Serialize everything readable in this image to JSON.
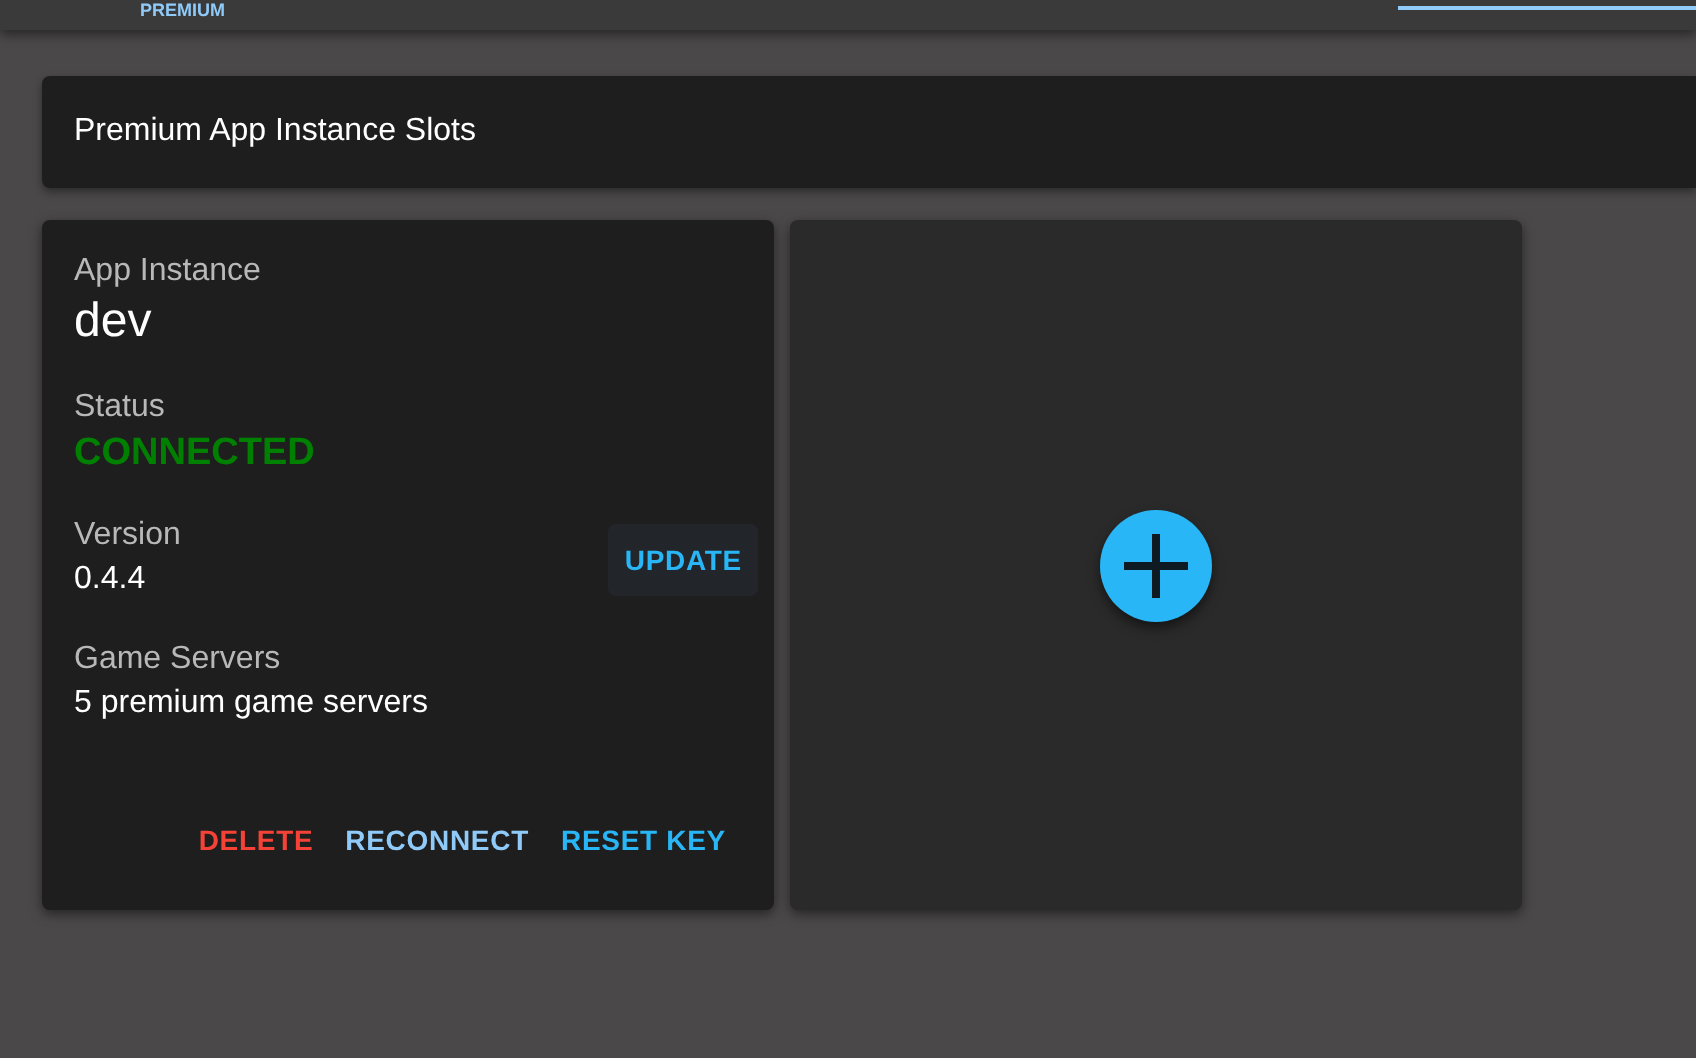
{
  "top_bar": {
    "brand_sub": "PREMIUM"
  },
  "section": {
    "title": "Premium App Instance Slots"
  },
  "instance_card": {
    "fields": [
      {
        "label": "App Instance",
        "value": "dev",
        "kind": "title"
      },
      {
        "label": "Status",
        "value": "CONNECTED",
        "kind": "status",
        "connected": true
      },
      {
        "label": "Version",
        "value": "0.4.4",
        "kind": "version",
        "action": "UPDATE"
      },
      {
        "label": "Game Servers",
        "value": "5 premium game servers",
        "kind": "plain"
      }
    ],
    "actions": [
      {
        "label": "DELETE",
        "kind": "danger"
      },
      {
        "label": "RECONNECT",
        "kind": "secondary"
      },
      {
        "label": "RESET KEY",
        "kind": "primary"
      }
    ]
  },
  "empty_slot": {
    "add": true
  }
}
